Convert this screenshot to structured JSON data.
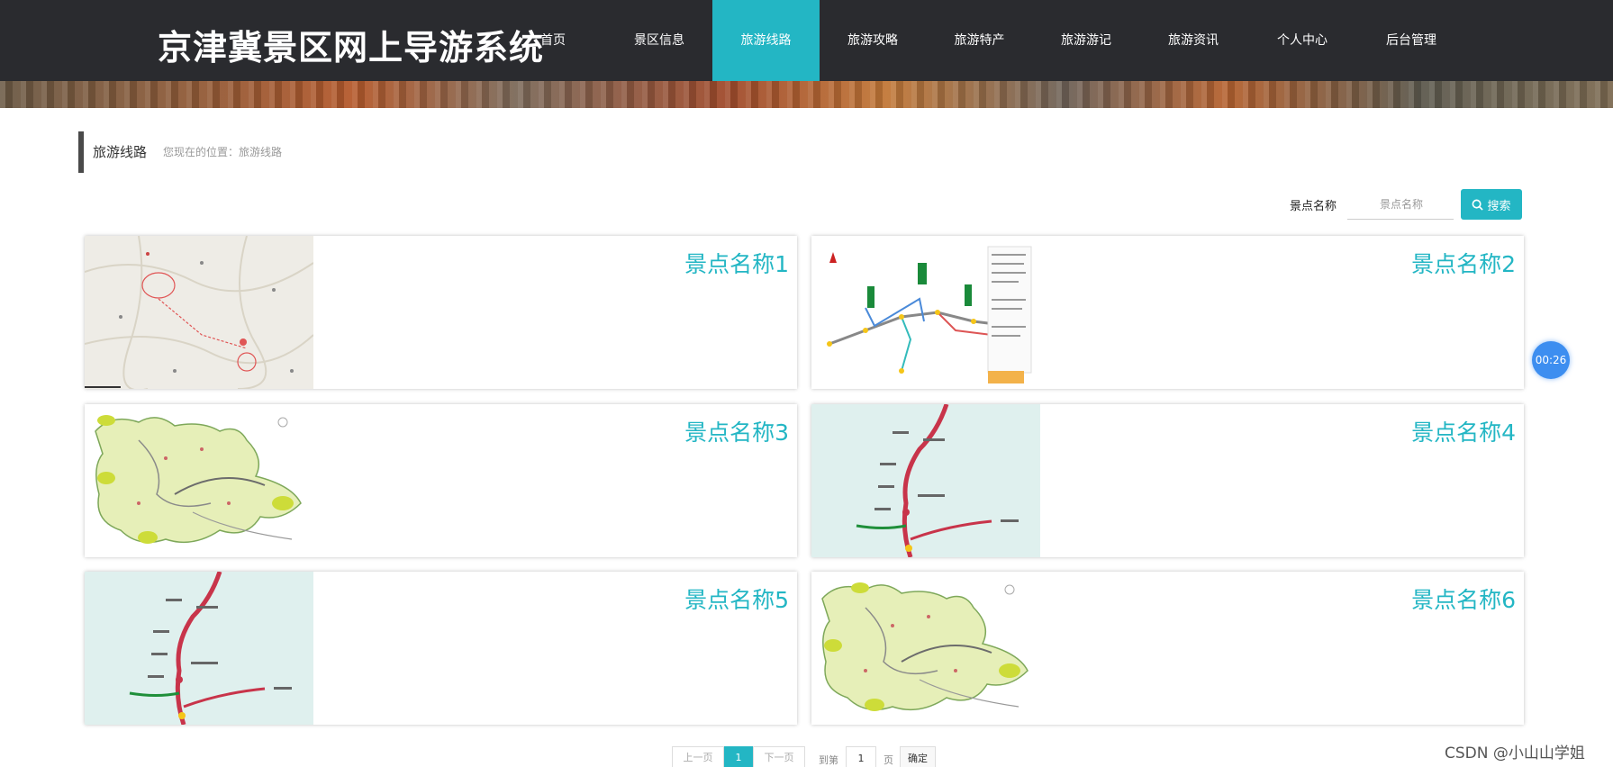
{
  "site": {
    "title": "京津冀景区网上导游系统"
  },
  "nav": {
    "items": [
      {
        "label": "首页",
        "active": false
      },
      {
        "label": "景区信息",
        "active": false
      },
      {
        "label": "旅游线路",
        "active": true
      },
      {
        "label": "旅游攻略",
        "active": false
      },
      {
        "label": "旅游特产",
        "active": false
      },
      {
        "label": "旅游游记",
        "active": false
      },
      {
        "label": "旅游资讯",
        "active": false
      },
      {
        "label": "个人中心",
        "active": false
      },
      {
        "label": "后台管理",
        "active": false
      }
    ]
  },
  "breadcrumb": {
    "title": "旅游线路",
    "path": "您现在的位置：旅游线路"
  },
  "search": {
    "label": "景点名称",
    "placeholder": "景点名称",
    "button_label": "搜索"
  },
  "cards": [
    {
      "name": "景点名称1",
      "image": "route-map-image"
    },
    {
      "name": "景点名称2",
      "image": "route-map-image"
    },
    {
      "name": "景点名称3",
      "image": "region-map-image"
    },
    {
      "name": "景点名称4",
      "image": "road-map-image"
    },
    {
      "name": "景点名称5",
      "image": "road-map-image"
    },
    {
      "name": "景点名称6",
      "image": "region-map-image"
    }
  ],
  "timer": {
    "text": "00:26"
  },
  "pagination": {
    "prev": "上一页",
    "current": "1",
    "next": "下一页",
    "goto_prefix": "到第",
    "goto_value": "1",
    "goto_suffix": "页",
    "confirm": "确定"
  },
  "watermark": "CSDN @小山山学姐",
  "colors": {
    "header_bg": "#2a2b2f",
    "accent": "#23b6c4",
    "timer": "#3d8ef0"
  }
}
